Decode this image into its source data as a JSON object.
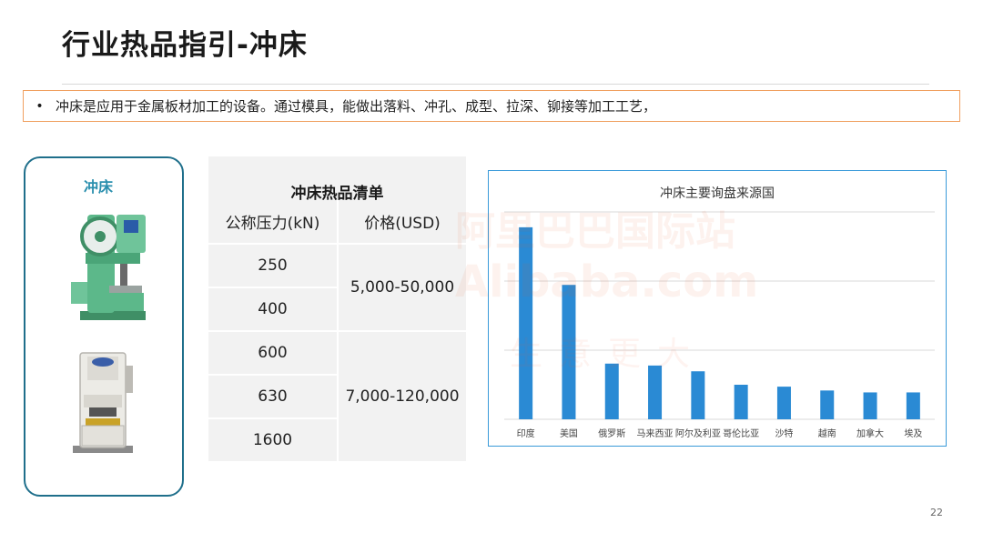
{
  "title": "行业热品指引-冲床",
  "bullet": {
    "marker": "•",
    "text": "冲床是应用于金属板材加工的设备。通过模具，能做出落料、冲孔、成型、拉深、铆接等加工工艺，"
  },
  "product_card": {
    "label": "冲床"
  },
  "price_table": {
    "title": "冲床热品清单",
    "headers": [
      "公称压力(kN)",
      "价格(USD)"
    ],
    "tonnages": [
      "250",
      "400",
      "600",
      "630",
      "1600"
    ],
    "price_ranges": [
      "5,000-50,000",
      "7,000-120,000"
    ]
  },
  "watermark": {
    "line1": "阿里巴巴国际站",
    "line2": "Alibaba.com",
    "line3": "生意更大"
  },
  "chart_data": {
    "type": "bar",
    "title": "冲床主要询盘来源国",
    "categories": [
      "印度",
      "美国",
      "俄罗斯",
      "马来西亚",
      "阿尔及利亚",
      "哥伦比亚",
      "沙特",
      "越南",
      "加拿大",
      "埃及"
    ],
    "values": [
      100,
      70,
      29,
      28,
      25,
      18,
      17,
      15,
      14,
      14
    ],
    "ylim": [
      0,
      108
    ],
    "bar_color": "#2a8ad4",
    "gridlines": [
      36,
      72,
      108
    ],
    "grid": true
  },
  "page_number": "22"
}
